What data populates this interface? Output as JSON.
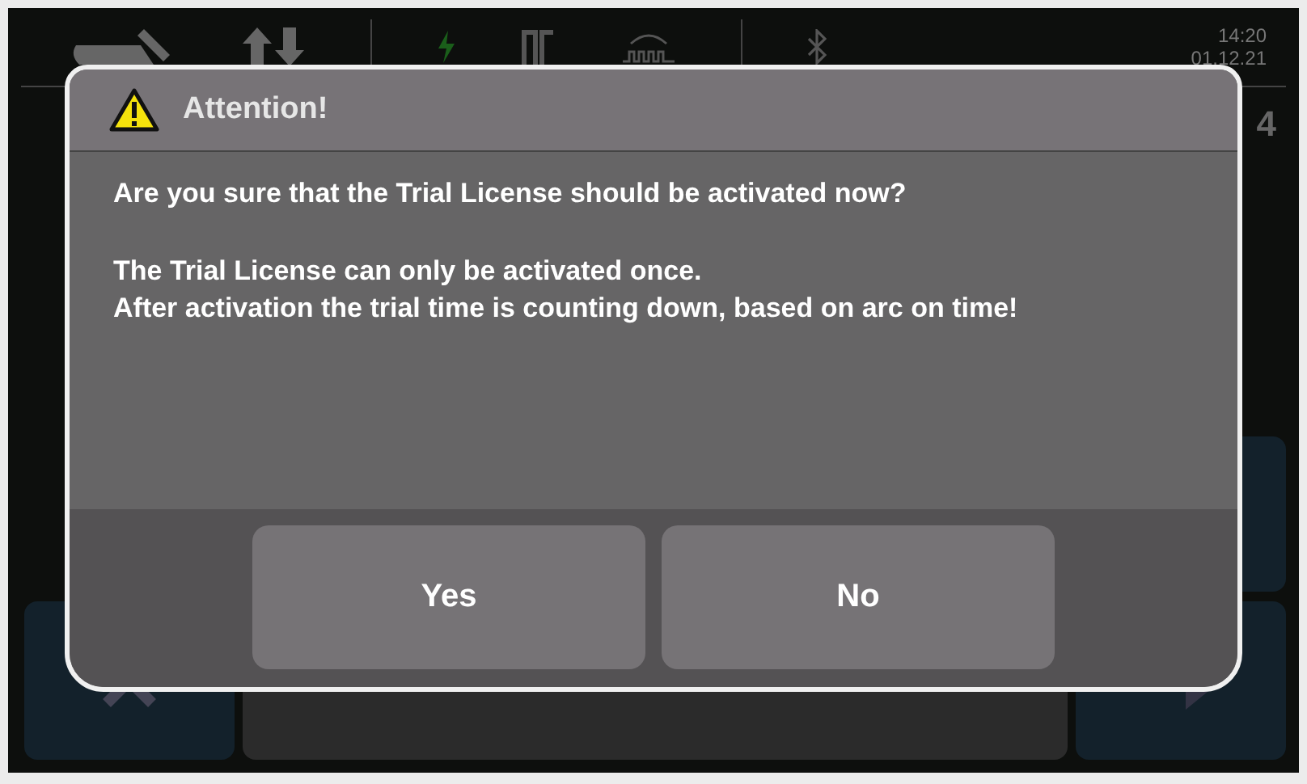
{
  "status_bar": {
    "time": "14:20",
    "date": "01.12.21"
  },
  "tab_number": "4",
  "dialog": {
    "title": "Attention!",
    "kind": "warning",
    "paragraphs": [
      "Are you sure that the Trial License should be activated now?",
      "The Trial License can only be activated once.\nAfter activation the trial time is counting down, based on arc on time!"
    ],
    "buttons": [
      "Yes",
      "No"
    ]
  }
}
